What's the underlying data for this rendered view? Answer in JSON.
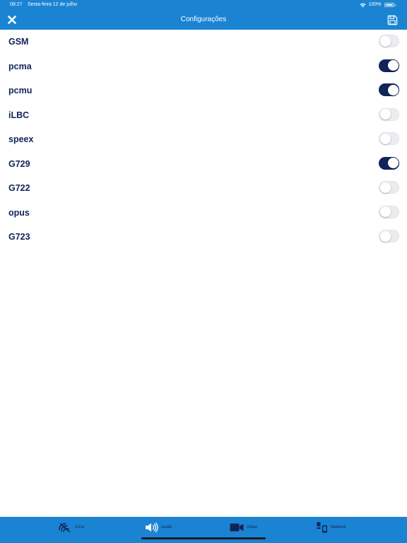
{
  "status_bar": {
    "time": "08:27",
    "date": "Sexta-feira 12 de julho",
    "battery": "100%"
  },
  "header": {
    "title": "Configurações",
    "close_icon": "close-x",
    "save_icon": "floppy-disk"
  },
  "codecs": [
    {
      "label": "GSM",
      "enabled": false
    },
    {
      "label": "pcma",
      "enabled": true
    },
    {
      "label": "pcmu",
      "enabled": true
    },
    {
      "label": "iLBC",
      "enabled": false
    },
    {
      "label": "speex",
      "enabled": false
    },
    {
      "label": "G729",
      "enabled": true
    },
    {
      "label": "G722",
      "enabled": false
    },
    {
      "label": "opus",
      "enabled": false
    },
    {
      "label": "G723",
      "enabled": false
    }
  ],
  "tabs": [
    {
      "label": "Ciclo",
      "icon": "calls-icon"
    },
    {
      "label": "Audio",
      "icon": "speaker-icon"
    },
    {
      "label": "Video",
      "icon": "video-camera-icon"
    },
    {
      "label": "Network",
      "icon": "network-icon"
    }
  ],
  "colors": {
    "header_bg": "#1a84d3",
    "accent": "#12235a",
    "toggle_off": "#ececf0"
  }
}
